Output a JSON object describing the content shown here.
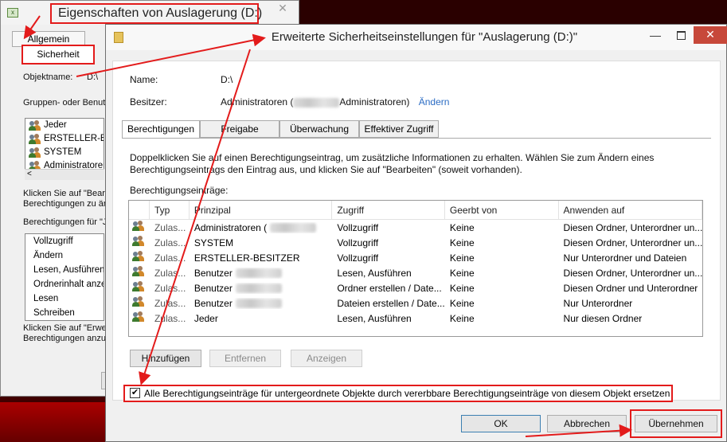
{
  "background_window": {
    "title": "Eigenschaften von Auslagerung (D:)",
    "close_glyph": "✕",
    "tabs": [
      {
        "label": "Allgemein"
      },
      {
        "label": "Sicherheit"
      }
    ],
    "objektname_label": "Objektname:",
    "objektname_value": "D:\\",
    "groups_label": "Gruppen- oder Benutz",
    "groups": [
      {
        "label": "Jeder"
      },
      {
        "label": "ERSTELLER-BESITZ"
      },
      {
        "label": "SYSTEM"
      },
      {
        "label": "Administratoren ("
      }
    ],
    "hint1_line1": "Klicken Sie auf \"Bearb",
    "hint1_line2": "Berechtigungen zu än",
    "perms_label": "Berechtigungen für \"J",
    "perms": [
      {
        "label": "Vollzugriff"
      },
      {
        "label": "Ändern"
      },
      {
        "label": "Lesen, Ausführen"
      },
      {
        "label": "Ordnerinhalt anzeige"
      },
      {
        "label": "Lesen"
      },
      {
        "label": "Schreiben"
      }
    ],
    "hint2_line1": "Klicken Sie auf \"Erwe",
    "hint2_line2": "Berechtigungen anzu",
    "scroll_arrow": "<"
  },
  "main_window": {
    "title": "Erweiterte Sicherheitseinstellungen für \"Auslagerung (D:)\"",
    "min_glyph": "—",
    "close_glyph": "✕",
    "name_label": "Name:",
    "name_value": "D:\\",
    "owner_label": "Besitzer:",
    "owner_value_pre": "Administratoren (",
    "owner_value_post": "Administratoren)",
    "owner_change_link": "Ändern",
    "tabs": [
      {
        "label": "Berechtigungen"
      },
      {
        "label": "Freigabe"
      },
      {
        "label": "Überwachung"
      },
      {
        "label": "Effektiver Zugriff"
      }
    ],
    "info_line1": "Doppelklicken Sie auf einen Berechtigungseintrag, um zusätzliche Informationen zu erhalten. Wählen Sie zum Ändern eines",
    "info_line2": "Berechtigungseintrags den Eintrag aus, und klicken Sie auf \"Bearbeiten\" (soweit vorhanden).",
    "entries_label": "Berechtigungseinträge:",
    "columns": [
      "Typ",
      "Prinzipal",
      "Zugriff",
      "Geerbt von",
      "Anwenden auf"
    ],
    "rows": [
      {
        "typ": "Zulas...",
        "prinzipal": "Administratoren (",
        "zugriff": "Vollzugriff",
        "geerbt": "Keine",
        "anwenden": "Diesen Ordner, Unterordner un..."
      },
      {
        "typ": "Zulas...",
        "prinzipal": "SYSTEM",
        "zugriff": "Vollzugriff",
        "geerbt": "Keine",
        "anwenden": "Diesen Ordner, Unterordner un..."
      },
      {
        "typ": "Zulas...",
        "prinzipal": "ERSTELLER-BESITZER",
        "zugriff": "Vollzugriff",
        "geerbt": "Keine",
        "anwenden": "Nur Unterordner und Dateien"
      },
      {
        "typ": "Zulas...",
        "prinzipal": "Benutzer",
        "zugriff": "Lesen, Ausführen",
        "geerbt": "Keine",
        "anwenden": "Diesen Ordner, Unterordner un..."
      },
      {
        "typ": "Zulas...",
        "prinzipal": "Benutzer",
        "zugriff": "Ordner erstellen / Date...",
        "geerbt": "Keine",
        "anwenden": "Diesen Ordner und Unterordner"
      },
      {
        "typ": "Zulas...",
        "prinzipal": "Benutzer",
        "zugriff": "Dateien erstellen / Date...",
        "geerbt": "Keine",
        "anwenden": "Nur Unterordner"
      },
      {
        "typ": "Zulas...",
        "prinzipal": "Jeder",
        "zugriff": "Lesen, Ausführen",
        "geerbt": "Keine",
        "anwenden": "Nur diesen Ordner"
      }
    ],
    "buttons": {
      "add": "Hinzufügen",
      "remove": "Entfernen",
      "view": "Anzeigen"
    },
    "checkbox_label": "Alle Berechtigungseinträge für untergeordnete Objekte durch vererbbare Berechtigungseinträge von diesem Objekt ersetzen",
    "checkbox_checked": true,
    "checkbox_mark": "✔",
    "footer": {
      "ok": "OK",
      "cancel": "Abbrechen",
      "apply": "Übernehmen"
    }
  },
  "colors": {
    "annotation_red": "#e31b1b",
    "close_button": "#c7483a",
    "link_blue": "#2b6cc4"
  }
}
